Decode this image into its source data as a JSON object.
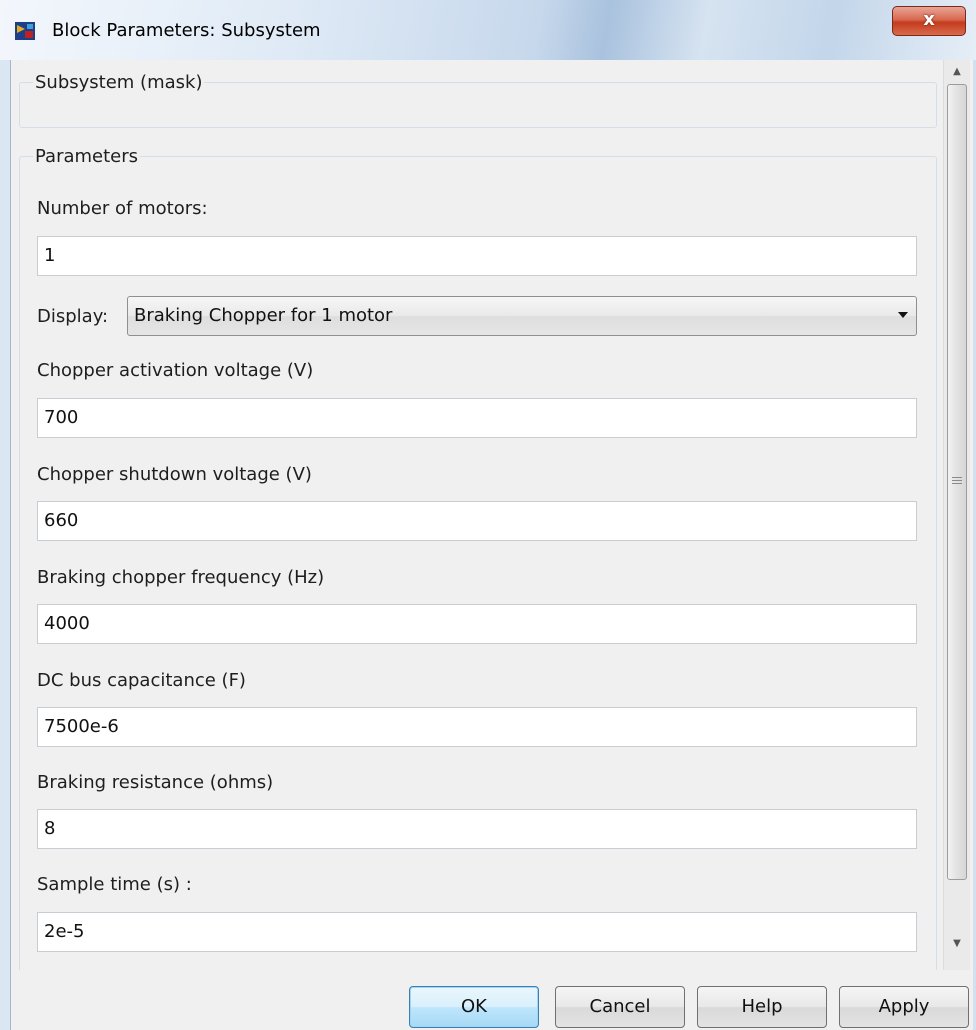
{
  "window": {
    "title": "Block Parameters: Subsystem",
    "close_label": "x"
  },
  "mask_group": {
    "legend": "Subsystem (mask)"
  },
  "parameters": {
    "legend": "Parameters",
    "num_motors": {
      "label": "Number of motors:",
      "value": "1"
    },
    "display": {
      "label": "Display:",
      "selected": "Braking Chopper for 1 motor"
    },
    "activation_voltage": {
      "label": "Chopper activation voltage (V)",
      "value": "700"
    },
    "shutdown_voltage": {
      "label": "Chopper shutdown voltage (V)",
      "value": "660"
    },
    "frequency": {
      "label": "Braking chopper frequency (Hz)",
      "value": "4000"
    },
    "capacitance": {
      "label": "DC bus capacitance (F)",
      "value": "7500e-6"
    },
    "resistance": {
      "label": "Braking resistance (ohms)",
      "value": "8"
    },
    "sample_time": {
      "label": "Sample time (s) :",
      "value": "2e-5"
    }
  },
  "buttons": {
    "ok": "OK",
    "cancel": "Cancel",
    "help": "Help",
    "apply": "Apply"
  },
  "icons": {
    "app": "simulink-block-icon",
    "scroll_up": "scroll-up-arrow-icon",
    "scroll_down": "scroll-down-arrow-icon",
    "dropdown": "chevron-down-icon"
  },
  "colors": {
    "close_button": "#c43b1e",
    "default_button_border": "#3c7fb1",
    "dialog_background": "#f0f0f0"
  }
}
